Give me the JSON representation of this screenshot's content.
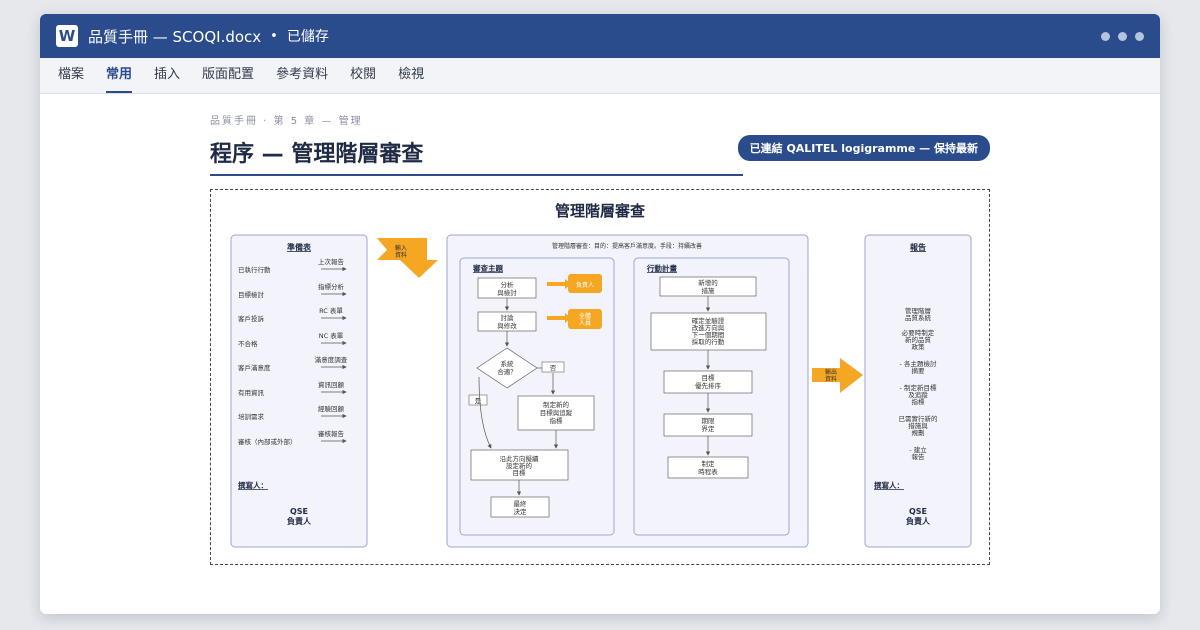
{
  "window": {
    "app_icon_letter": "W",
    "title": "品質手冊 — SCOQI.docx",
    "separator": "•",
    "save_status": "已儲存"
  },
  "ribbon": {
    "tabs": [
      "檔案",
      "常用",
      "插入",
      "版面配置",
      "參考資料",
      "校閱",
      "檢視"
    ],
    "active_tab": "常用"
  },
  "document": {
    "breadcrumb": "品質手冊 · 第 5 章 — 管理",
    "title": "程序 — 管理階層審查",
    "link_badge": "已連結 QALITEL logigramme — 保持最新"
  },
  "diagram": {
    "title": "管理階層審查",
    "prep": {
      "heading": "準備表",
      "rows": [
        {
          "left": "已執行行動",
          "right": "上次報告"
        },
        {
          "left": "目標檢討",
          "right": "指標分析"
        },
        {
          "left": "客戶投訴",
          "right": "RC 表單"
        },
        {
          "left": "不合格",
          "right": "NC 表單"
        },
        {
          "left": "客戶滿意度",
          "right": "滿意度調查"
        },
        {
          "left": "有用資訊",
          "right": "資訊回顧"
        },
        {
          "left": "培訓需求",
          "right": "經驗回顧"
        },
        {
          "left": "審核（內部或外部）",
          "right": "審核報告"
        }
      ],
      "author_label": "撰寫人：",
      "author_line1": "QSE",
      "author_line2": "負責人"
    },
    "input_arrow": {
      "line1": "輸入",
      "line2": "資料"
    },
    "output_arrow": {
      "line1": "輸出",
      "line2": "資料"
    },
    "center": {
      "objective": "管理階層審查：目的：提高客戶滿意度。手段：持續改善",
      "review": {
        "heading": "審查主題",
        "analyze": {
          "line1": "分析",
          "line2": "與檢討"
        },
        "discuss": {
          "line1": "討論",
          "line2": "與修改"
        },
        "decision": {
          "line1": "系統",
          "line2": "合適？"
        },
        "no": "否",
        "yes": "是",
        "responsible": "負責人",
        "all_staff": {
          "line1": "全體",
          "line2": "人員"
        },
        "new_targets": {
          "line1": "制定新的",
          "line2": "目標與追蹤",
          "line3": "指標"
        },
        "direction": {
          "line1": "沿此方向擬續",
          "line2": "設定新的",
          "line3": "目標"
        },
        "final": {
          "line1": "最終",
          "line2": "決定"
        }
      },
      "plan": {
        "heading": "行動計畫",
        "new_actions": {
          "line1": "新增的",
          "line2": "措施"
        },
        "define": {
          "line1": "確定並驗證",
          "line2": "改進方向與",
          "line3": "下一個期間",
          "line4": "採取的行動"
        },
        "priority": {
          "line1": "目標",
          "line2": "優先排序"
        },
        "timeline": {
          "line1": "期限",
          "line2": "界定"
        },
        "schedule": {
          "line1": "制定",
          "line2": "時程表"
        }
      }
    },
    "report": {
      "heading": "報告",
      "items": [
        [
          "管理階層",
          "品質系統"
        ],
        [
          "必要時制定",
          "新的品質",
          "政策"
        ],
        [
          "- 各主題檢討",
          "摘要"
        ],
        [
          "- 制定新目標",
          "及追蹤",
          "指標"
        ],
        [
          "已需實行新的",
          "措施與",
          "規劃"
        ],
        [
          "- 建立",
          "報告"
        ]
      ],
      "author_label": "撰寫人：",
      "author_line1": "QSE",
      "author_line2": "負責人"
    }
  },
  "colors": {
    "brand": "#2b4c8c",
    "lane_fill": "#f2f3fb",
    "lane_stroke": "#9da6cf",
    "accent_orange": "#f5a623"
  }
}
